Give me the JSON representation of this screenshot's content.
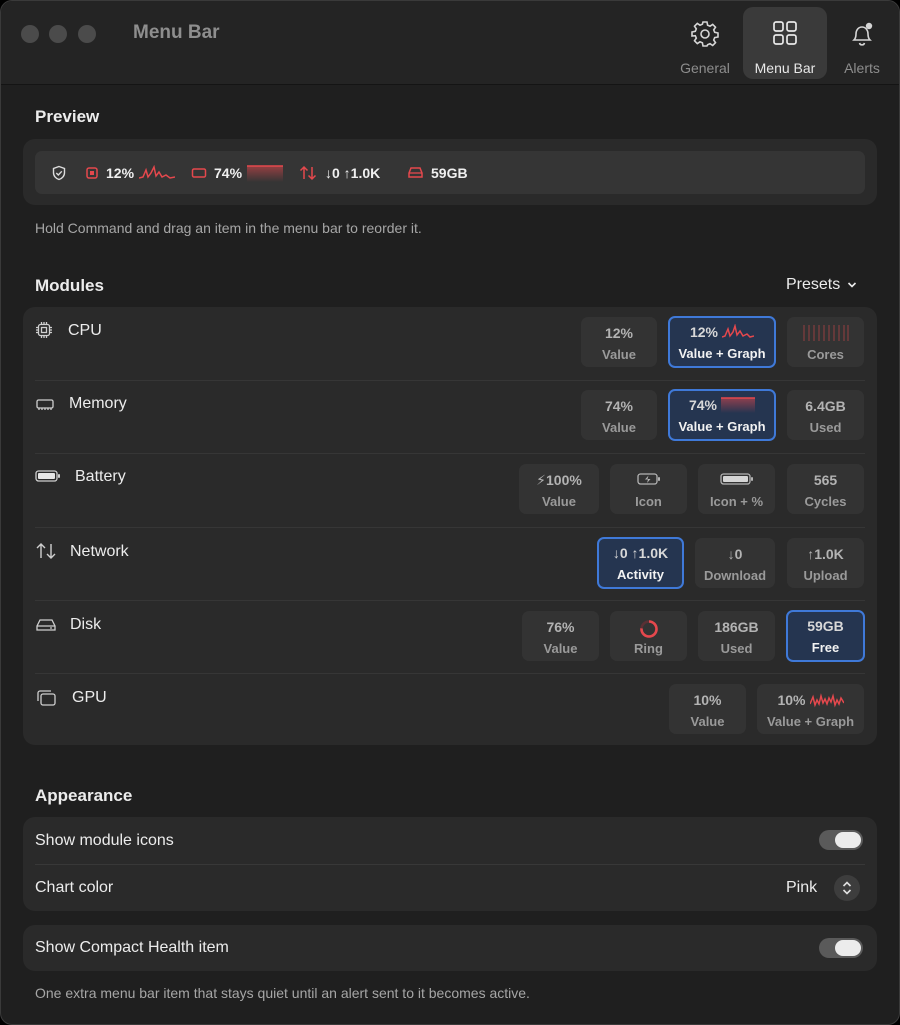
{
  "window": {
    "title": "Menu Bar"
  },
  "toolbar": {
    "general_label": "General",
    "menubar_label": "Menu Bar",
    "alerts_label": "Alerts"
  },
  "preview": {
    "title": "Preview",
    "cpu_value": "12%",
    "memory_value": "74%",
    "network_value": "↓0 ↑1.0K",
    "disk_value": "59GB",
    "hint": "Hold Command and drag an item in the menu bar to reorder it."
  },
  "modules": {
    "title": "Modules",
    "presets_label": "Presets",
    "rows": [
      {
        "name": "CPU",
        "options": [
          {
            "value": "12%",
            "label": "Value"
          },
          {
            "value": "12%",
            "label": "Value + Graph",
            "selected": true
          },
          {
            "value": "",
            "label": "Cores"
          }
        ]
      },
      {
        "name": "Memory",
        "options": [
          {
            "value": "74%",
            "label": "Value"
          },
          {
            "value": "74%",
            "label": "Value + Graph",
            "selected": true
          },
          {
            "value": "6.4GB",
            "label": "Used"
          }
        ]
      },
      {
        "name": "Battery",
        "options": [
          {
            "value": "⚡100%",
            "label": "Value"
          },
          {
            "value": "",
            "label": "Icon"
          },
          {
            "value": "",
            "label": "Icon + %"
          },
          {
            "value": "565",
            "label": "Cycles"
          }
        ]
      },
      {
        "name": "Network",
        "options": [
          {
            "value": "↓0 ↑1.0K",
            "label": "Activity",
            "selected": true
          },
          {
            "value": "↓0",
            "label": "Download"
          },
          {
            "value": "↑1.0K",
            "label": "Upload"
          }
        ]
      },
      {
        "name": "Disk",
        "options": [
          {
            "value": "76%",
            "label": "Value"
          },
          {
            "value": "",
            "label": "Ring"
          },
          {
            "value": "186GB",
            "label": "Used"
          },
          {
            "value": "59GB",
            "label": "Free",
            "selected": true
          }
        ]
      },
      {
        "name": "GPU",
        "options": [
          {
            "value": "10%",
            "label": "Value"
          },
          {
            "value": "10%",
            "label": "Value + Graph"
          }
        ]
      }
    ]
  },
  "appearance": {
    "title": "Appearance",
    "show_icons_label": "Show module icons",
    "show_icons_on": true,
    "chart_color_label": "Chart color",
    "chart_color_value": "Pink",
    "compact_label": "Show Compact Health item",
    "compact_on": true,
    "compact_hint": "One extra menu bar item that stays quiet until an alert sent to it becomes active."
  },
  "colors": {
    "accent_pink": "#e5484d",
    "selection_blue": "#3f79d8"
  }
}
